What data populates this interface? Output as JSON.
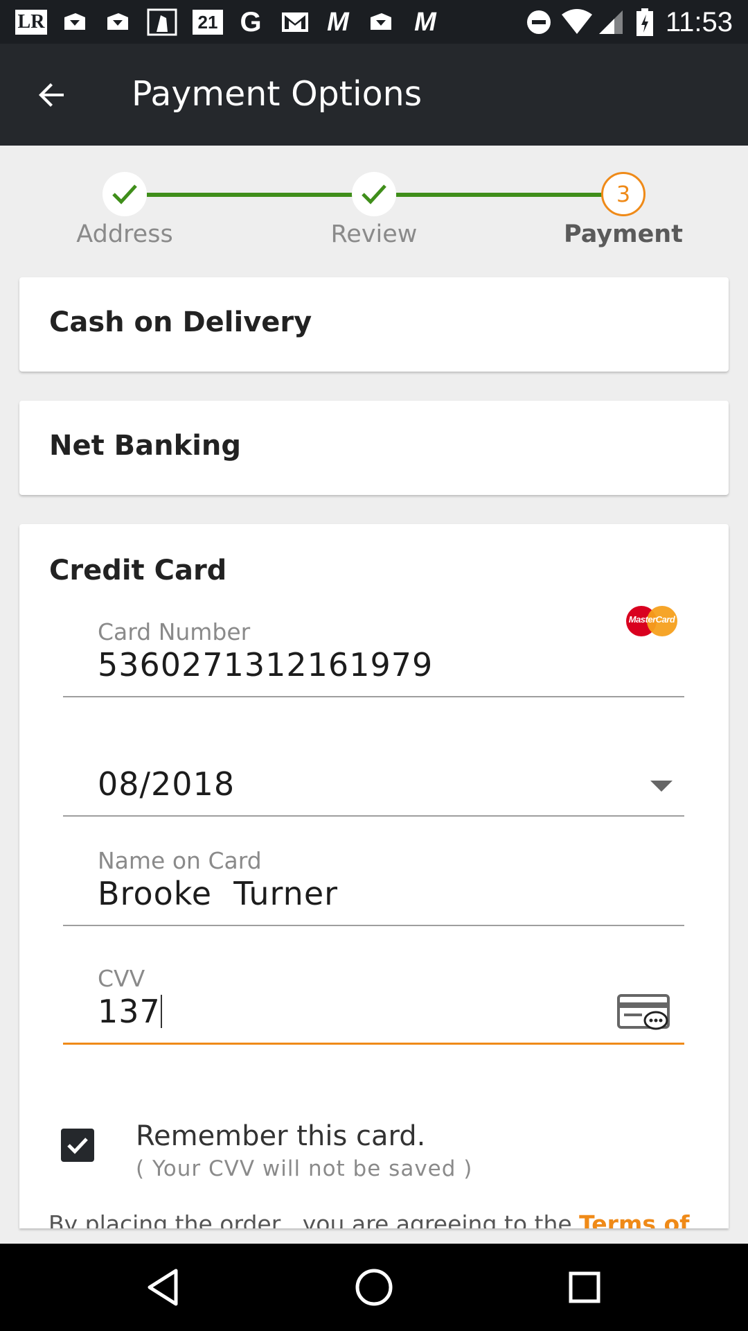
{
  "status_bar": {
    "time": "11:53",
    "app_icons": [
      "LR",
      "gift-icon",
      "gift-icon",
      "snapchat-icon",
      "21",
      "G",
      "gmail-icon",
      "M",
      "gift-icon",
      "M"
    ]
  },
  "toolbar": {
    "title": "Payment Options"
  },
  "stepper": {
    "steps": [
      {
        "label": "Address",
        "state": "done"
      },
      {
        "label": "Review",
        "state": "done"
      },
      {
        "label": "Payment",
        "state": "active",
        "number": "3"
      }
    ]
  },
  "payment_methods": {
    "cod_label": "Cash on Delivery",
    "netbanking_label": "Net Banking",
    "credit_card": {
      "title": "Credit Card",
      "brand": "MasterCard",
      "card_number_label": "Card Number",
      "card_number": "5360271312161979",
      "expiry": "08/2018",
      "name_label": "Name on Card",
      "name": "Brooke  Turner",
      "cvv_label": "CVV",
      "cvv": "137",
      "remember_label": "Remember this card.",
      "remember_sub": "( Your CVV will not be saved )",
      "remember_checked": true,
      "terms_prefix": "By placing the order , you are agreeing to the ",
      "terms_link": "Terms of"
    }
  },
  "colors": {
    "accent": "#ef8a18",
    "step_done": "#3f8e1a",
    "toolbar": "#25282c"
  }
}
